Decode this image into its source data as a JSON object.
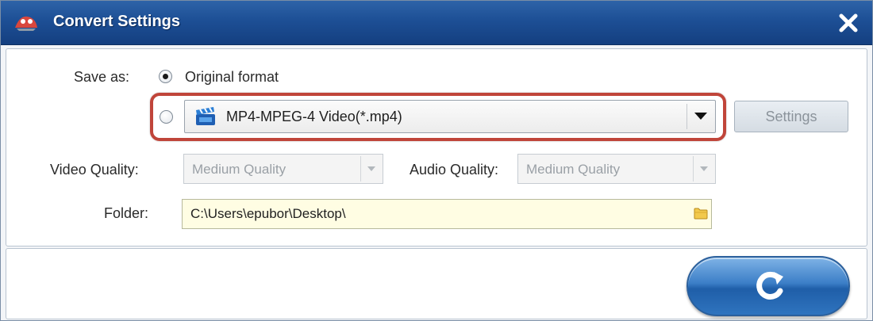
{
  "window": {
    "title": "Convert Settings"
  },
  "save_as": {
    "label": "Save as:",
    "original_option_label": "Original format",
    "format_selected": "MP4-MPEG-4 Video(*.mp4)",
    "settings_button_label": "Settings"
  },
  "quality": {
    "video_label": "Video Quality:",
    "video_value": "Medium Quality",
    "audio_label": "Audio Quality:",
    "audio_value": "Medium Quality"
  },
  "folder": {
    "label": "Folder:",
    "path": "C:\\Users\\epubor\\Desktop\\"
  },
  "icons": {
    "app": "app-logo-icon",
    "close": "close-icon",
    "format": "clapperboard-icon",
    "folder": "folder-icon",
    "convert": "refresh-icon"
  },
  "colors": {
    "titlebar": "#1d4f95",
    "highlight": "#c0453a",
    "folder_bg": "#fffde3",
    "convert_button": "#3b7ec7"
  }
}
